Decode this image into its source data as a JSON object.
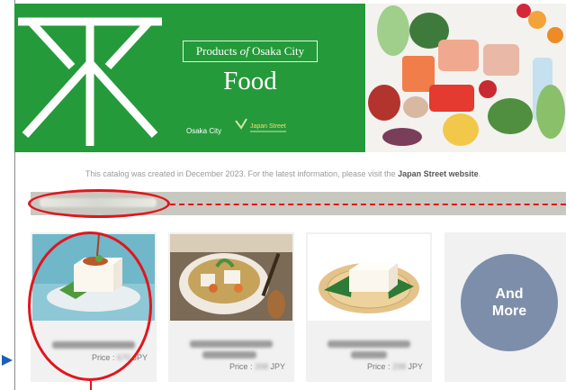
{
  "banner": {
    "tagline_pre": "Products ",
    "tagline_of": "of",
    "tagline_post": " Osaka City",
    "title": "Food",
    "city_label": "Osaka City",
    "logo_text": "Japan Street"
  },
  "catalog_note": {
    "prefix": "This catalog was created in December 2023. For the latest information, please visit the ",
    "link": "Japan Street website",
    "suffix": "."
  },
  "section": {
    "title_blurred": "Sesame Tofu Store"
  },
  "products": [
    {
      "name": "Silken tofu",
      "price_label": "Price : ",
      "price_value": "670",
      "currency": " JPY"
    },
    {
      "name": "Shiitake tofu soup",
      "price_label": "Price : ",
      "price_value": "398",
      "currency": " JPY"
    },
    {
      "name": "Firm tofu block",
      "price_label": "Price : ",
      "price_value": "298",
      "currency": " JPY"
    }
  ],
  "more_card": {
    "line1": "And",
    "line2": "More"
  },
  "colors": {
    "banner_green": "#259a3a",
    "highlight_red": "#e0161e",
    "more_circle": "#7c8ea9",
    "section_bar": "#c8c8c0"
  }
}
